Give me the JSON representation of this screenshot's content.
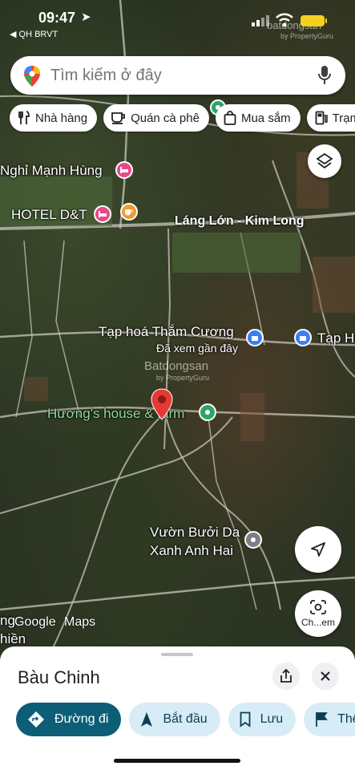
{
  "status": {
    "time": "09:47",
    "back_app": "◀ QH BRVT"
  },
  "search": {
    "placeholder": "Tìm kiếm ở đây"
  },
  "chips": [
    "Nhà hàng",
    "Quán cà phê",
    "Mua sắm",
    "Trạm"
  ],
  "map_labels": {
    "nghi_manh_hung": "Nghỉ Mạnh Hùng",
    "hotel_dt": "HOTEL D&T",
    "road": "Láng Lớn - Kim Long",
    "tap_hoa": "Tạp hoá Thắm Cương",
    "tap_hoa_2": "Tạp H",
    "recent": "Đã xem gần đây",
    "huong_house": "Hương's house & farm",
    "vuon_buoi_1": "Vườn Bưởi Da",
    "vuon_buoi_2": "Xanh Anh Hai",
    "left_edge_1": "ng",
    "left_edge_2": "hiền"
  },
  "watermarks": {
    "top": "batdongsan",
    "top_sub": "by PropertyGuru",
    "center": "Batdongsan",
    "center_sub": "by PropertyGuru"
  },
  "logos": {
    "google": "Google",
    "maps": "Maps"
  },
  "lens_label": "Ch...em",
  "sheet": {
    "title": "Bàu Chinh",
    "actions": [
      "Đường đi",
      "Bắt đầu",
      "Lưu",
      "Thê"
    ]
  },
  "colors": {
    "primary": "#0b5e75",
    "tonal": "#d7ecf7",
    "pin": "#e53935"
  }
}
